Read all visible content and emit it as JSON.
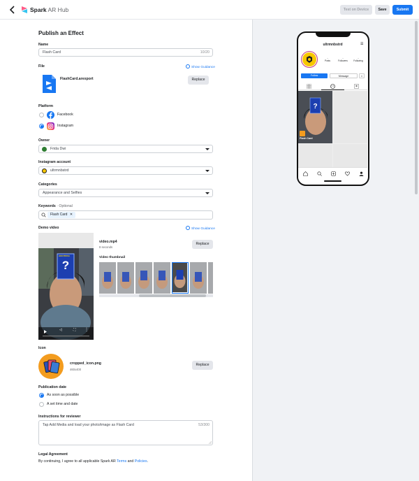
{
  "header": {
    "brand_bold": "Spark",
    "brand_rest": " AR Hub",
    "test_on_device": "Test on Device",
    "save": "Save",
    "submit": "Submit"
  },
  "form": {
    "title": "Publish an Effect",
    "name_label": "Name",
    "name_value": "Flash Card",
    "name_count": "10/20",
    "file_label": "File",
    "show_guidance": "Show Guidance",
    "file_name": "FlashCard.arexport",
    "replace": "Replace",
    "platform_label": "Platform",
    "platforms": [
      "Facebook",
      "Instagram"
    ],
    "owner_label": "Owner",
    "owner_value": "Frida Dwi",
    "ig_label": "Instagram account",
    "ig_value": "ultrmnbstrd",
    "categories_label": "Categories",
    "categories_value": "Appearance and Selfies",
    "keywords_label": "Keywords",
    "keywords_optional": "· Optional",
    "keyword_chip": "Flash Card",
    "demo_label": "Demo video",
    "video_name": "video.mp4",
    "video_duration": "8 seconds",
    "video_thumbnail_label": "Video thumbnail",
    "icon_label": "Icon",
    "icon_file": "cropped_icon.png",
    "icon_size": "460x400",
    "pubdate_label": "Publication date",
    "pub_options": [
      "As soon as possible",
      "A set time and date"
    ],
    "instructions_label": "Instructions for reviewer",
    "instructions_value": "Tap Add Media and load your photo/image as Flash Card",
    "instructions_count": "53/300",
    "legal_label": "Legal Agreement",
    "legal_text_1": "By continuing, I agree to all applicable Spark AR ",
    "legal_terms": "Terms",
    "legal_and": " and ",
    "legal_policies": "Policies",
    "legal_end": "."
  },
  "preview": {
    "username": "ultrmnbstrd",
    "stats": [
      {
        "num": "-",
        "label": "Posts"
      },
      {
        "num": "-",
        "label": "Followers"
      },
      {
        "num": "-",
        "label": "Following"
      }
    ],
    "follow": "Follow",
    "message": "Message",
    "tile_label": "Flash Card",
    "card_text": "HOO PROSA"
  },
  "colors": {
    "accent": "#1877f2",
    "panel": "#f0f2f5"
  }
}
